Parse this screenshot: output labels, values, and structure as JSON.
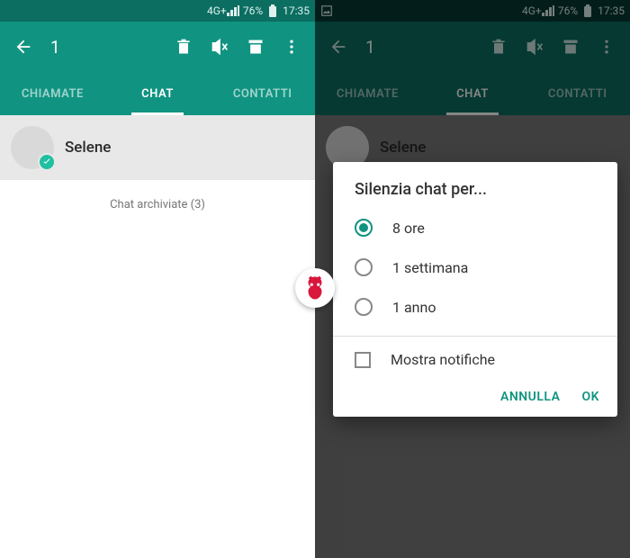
{
  "status": {
    "network": "4G+",
    "battery": "76%",
    "time": "17:35"
  },
  "toolbar": {
    "selected_count": "1"
  },
  "tabs": {
    "calls": "CHIAMATE",
    "chat": "CHAT",
    "contacts": "CONTATTI"
  },
  "chat": {
    "name": "Selene"
  },
  "archived": {
    "label": "Chat archiviate (3)"
  },
  "dialog": {
    "title": "Silenzia chat per...",
    "opt1": "8 ore",
    "opt2": "1 settimana",
    "opt3": "1 anno",
    "show_notifications": "Mostra notifiche",
    "cancel": "ANNULLA",
    "ok": "OK"
  }
}
